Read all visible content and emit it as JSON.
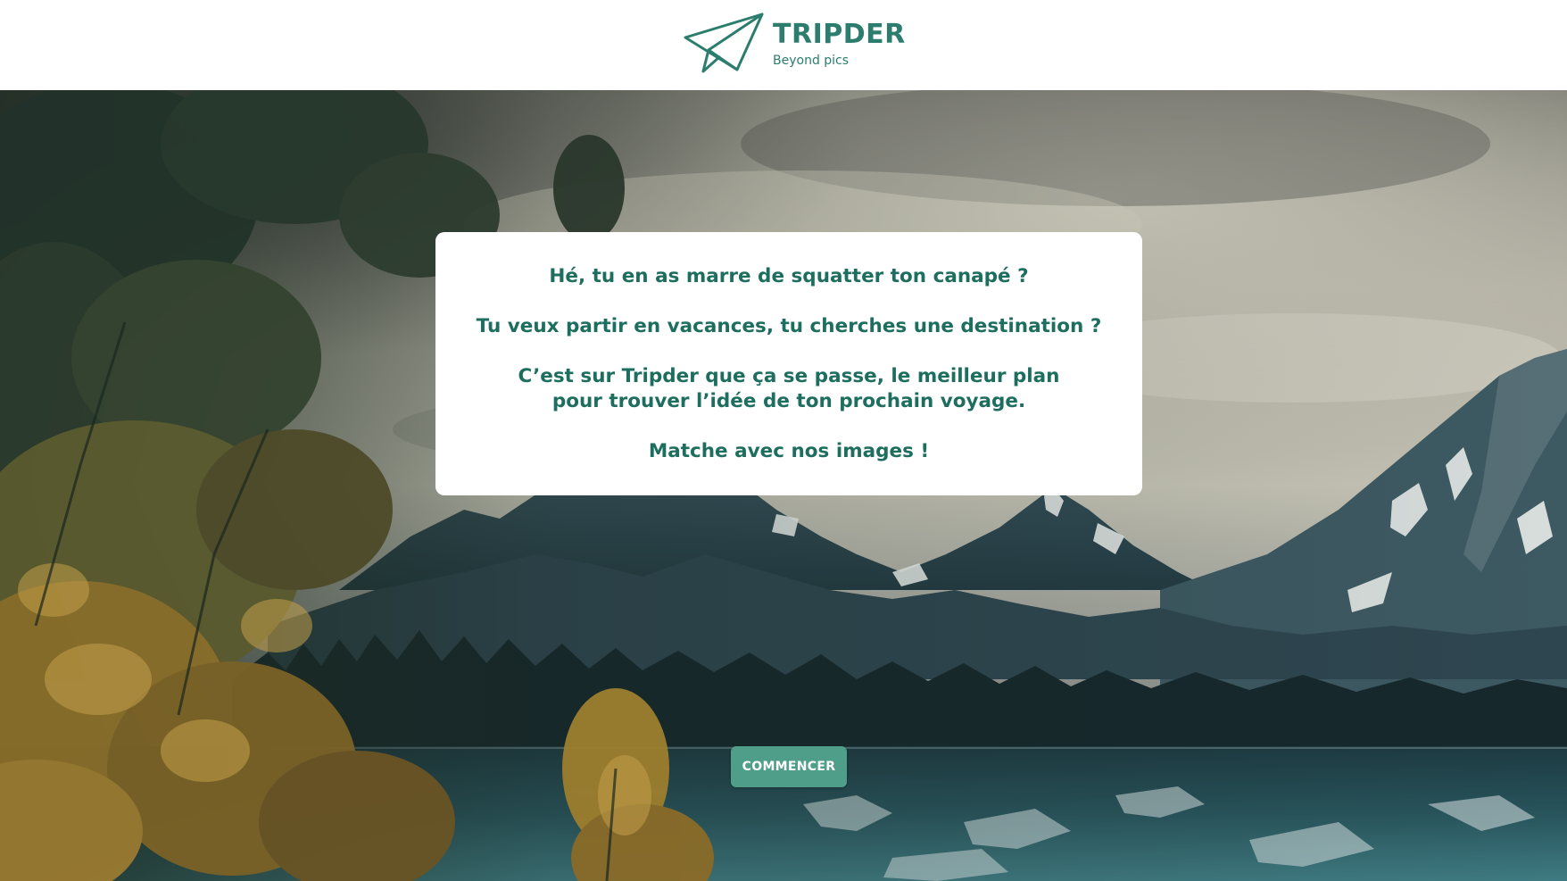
{
  "header": {
    "brand": "TRIPDER",
    "tagline": "Beyond pics",
    "logo_icon": "paper-plane-icon"
  },
  "welcome_card": {
    "line1": "Hé, tu en as marre de squatter ton canapé ?",
    "line2": "Tu veux partir en vacances, tu cherches une destination ?",
    "line3": "C’est sur Tripder que ça se passe, le meilleur plan pour trouver l’idée de ton prochain voyage.",
    "line4": "Matche avec nos images !"
  },
  "cta": {
    "label": "COMMENCER"
  },
  "colors": {
    "brand_green": "#2c7d6d",
    "card_text": "#1e6e60",
    "button_bg": "#4f9e8a"
  }
}
